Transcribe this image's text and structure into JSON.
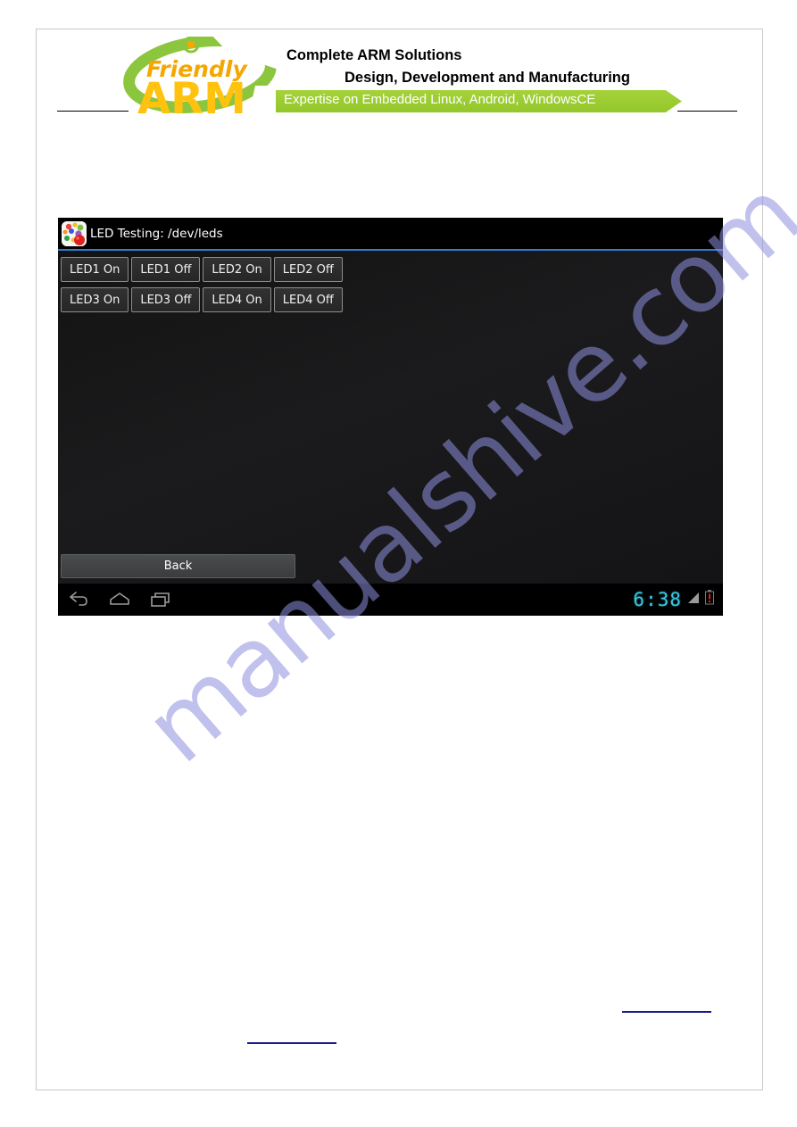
{
  "document": {
    "header": {
      "logo": {
        "name": "friendlyarm-logo",
        "word_top": "Friendly",
        "word_bottom": "ARM",
        "color_word_top": "#f5a600",
        "color_word_bottom": "#ffc20e",
        "color_swoosh": "#8cc63e"
      },
      "tagline_line1": "Complete ARM Solutions",
      "tagline_line2": "Design, Development and  Manufacturing",
      "banner_text": "Expertise on Embedded Linux, Android, WindowsCE",
      "banner_color": "#9ACD32"
    },
    "watermark": "manualshive.com",
    "links": [
      {
        "name": "link-left",
        "text": ""
      },
      {
        "name": "link-right",
        "text": ""
      }
    ]
  },
  "screenshot": {
    "titlebar": {
      "icon": "colorful-balls-app-icon",
      "title": "LED Testing: /dev/leds",
      "divider_color": "#2c7fd4"
    },
    "buttons": {
      "row1": [
        {
          "name": "led1-on-button",
          "label": "LED1 On"
        },
        {
          "name": "led1-off-button",
          "label": "LED1 Off"
        },
        {
          "name": "led2-on-button",
          "label": "LED2 On"
        },
        {
          "name": "led2-off-button",
          "label": "LED2 Off"
        }
      ],
      "row2": [
        {
          "name": "led3-on-button",
          "label": "LED3 On"
        },
        {
          "name": "led3-off-button",
          "label": "LED3 Off"
        },
        {
          "name": "led4-on-button",
          "label": "LED4 On"
        },
        {
          "name": "led4-off-button",
          "label": "LED4 Off"
        }
      ],
      "back_label": "Back"
    },
    "navbar": {
      "icons": [
        {
          "name": "back-arrow-icon"
        },
        {
          "name": "home-icon"
        },
        {
          "name": "recents-icon"
        }
      ],
      "clock": "6:38",
      "clock_color": "#39c6de",
      "status_icons": [
        {
          "name": "signal-icon"
        },
        {
          "name": "battery-alert-icon"
        }
      ]
    }
  }
}
